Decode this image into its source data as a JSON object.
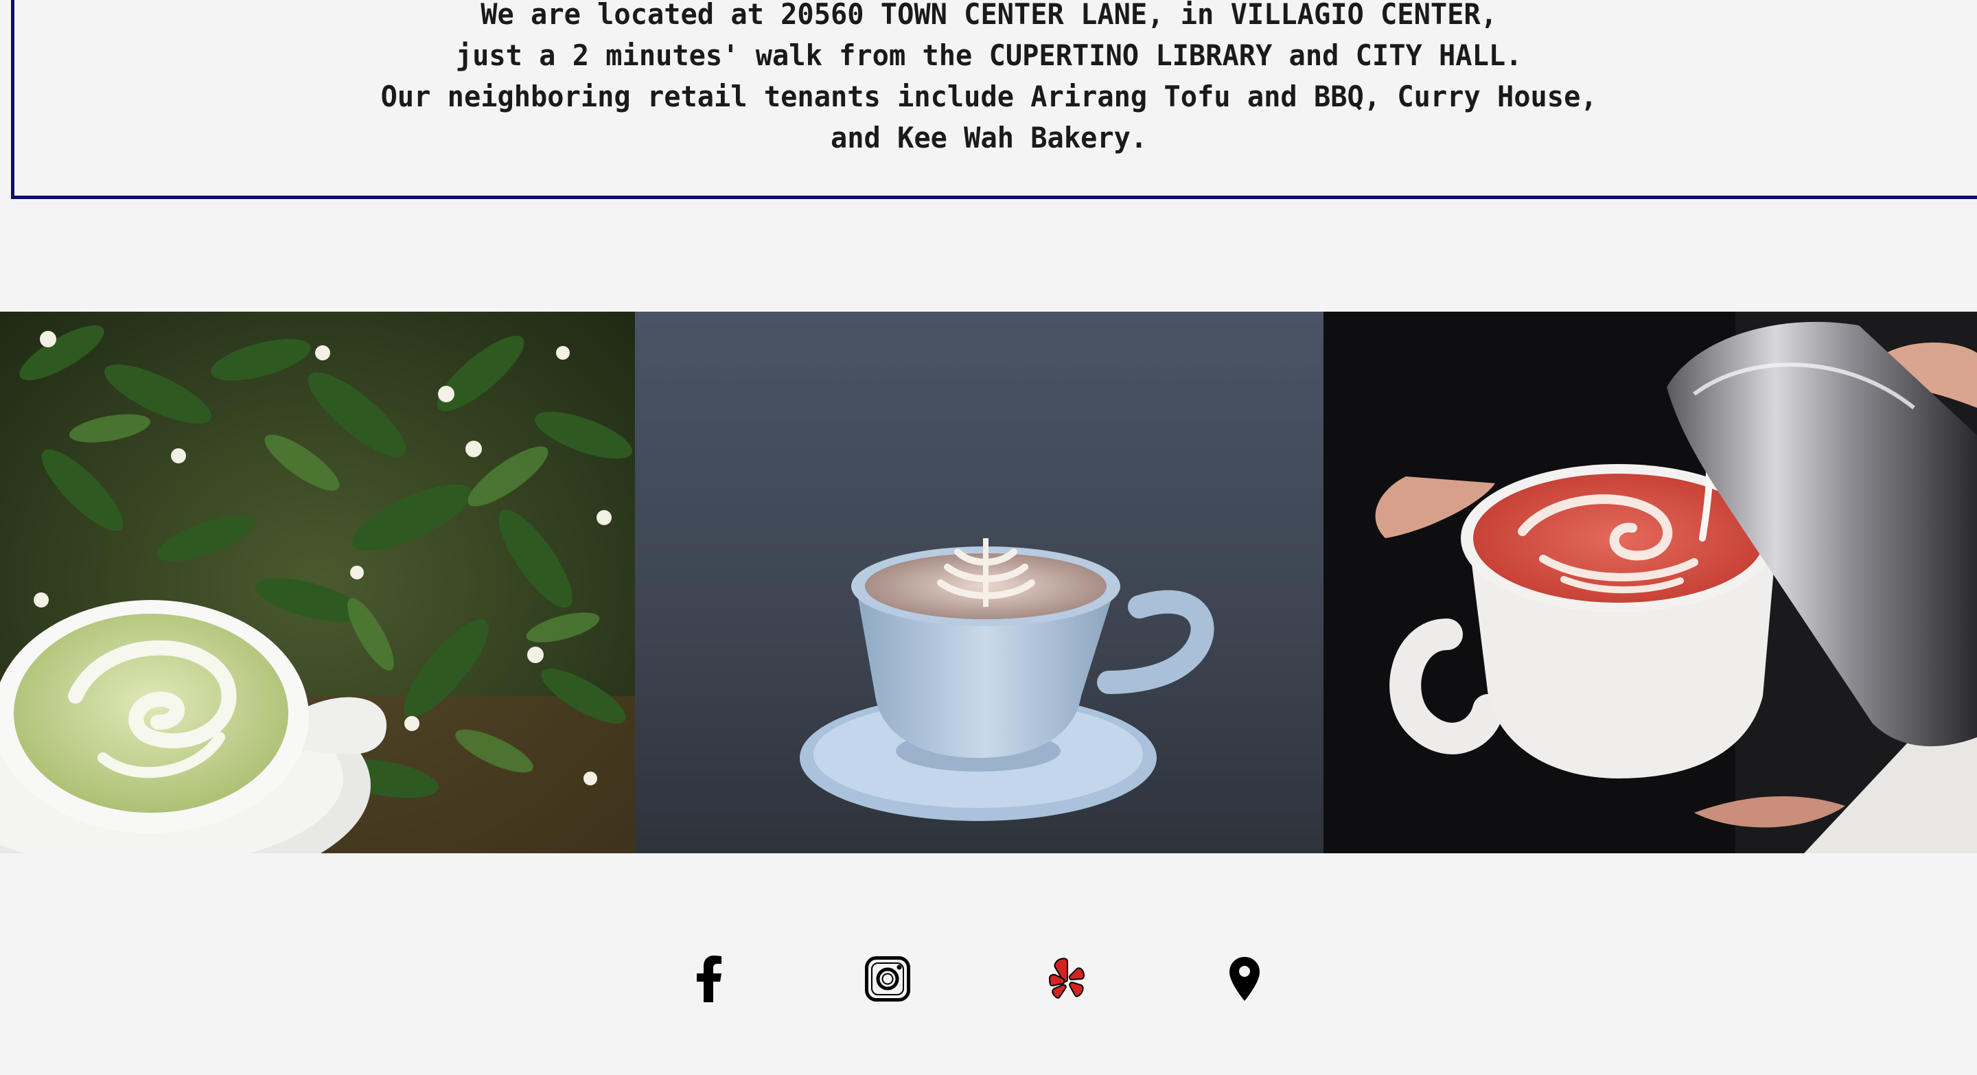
{
  "location": {
    "lines": [
      "We are located at 20560 TOWN CENTER LANE, in VILLAGIO CENTER,",
      "just a 2 minutes' walk from the CUPERTINO LIBRARY and CITY HALL.",
      "Our neighboring retail tenants include Arirang Tofu and BBQ, Curry House,",
      "and Kee Wah Bakery."
    ],
    "border_color": "#0c0c72"
  },
  "gallery": {
    "images": [
      {
        "icon": "matcha-latte-photo"
      },
      {
        "icon": "cappuccino-photo"
      },
      {
        "icon": "red-velvet-latte-pour-photo"
      }
    ]
  },
  "social": {
    "links": [
      {
        "icon": "facebook-icon",
        "color": "#000000"
      },
      {
        "icon": "instagram-icon",
        "color": "#000000"
      },
      {
        "icon": "yelp-icon",
        "color": "#d32323"
      },
      {
        "icon": "map-pin-icon",
        "color": "#000000"
      }
    ]
  },
  "colors": {
    "background": "#f4f4f4",
    "text": "#1a1a1a"
  }
}
